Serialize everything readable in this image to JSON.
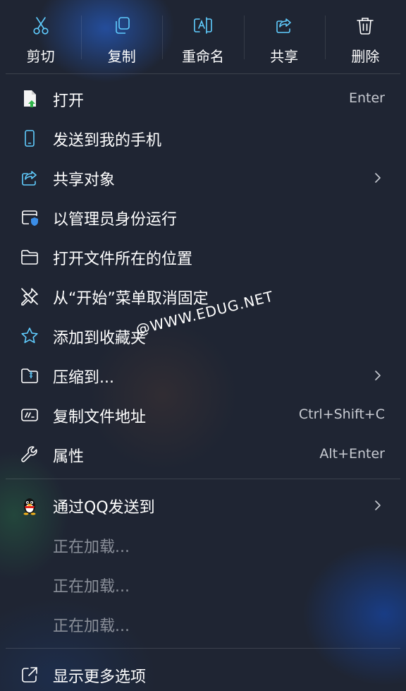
{
  "toolbar": {
    "cut": "剪切",
    "copy": "复制",
    "rename": "重命名",
    "share": "共享",
    "delete": "删除"
  },
  "items": {
    "open": {
      "label": "打开",
      "shortcut": "Enter"
    },
    "send_phone": {
      "label": "发送到我的手机"
    },
    "share_object": {
      "label": "共享对象"
    },
    "run_admin": {
      "label": "以管理员身份运行"
    },
    "open_location": {
      "label": "打开文件所在的位置"
    },
    "unpin_start": {
      "label": "从“开始”菜单取消固定"
    },
    "add_favorites": {
      "label": "添加到收藏夹"
    },
    "compress": {
      "label": "压缩到..."
    },
    "copy_path": {
      "label": "复制文件地址",
      "shortcut": "Ctrl+Shift+C"
    },
    "properties": {
      "label": "属性",
      "shortcut": "Alt+Enter"
    },
    "send_qq": {
      "label": "通过QQ发送到"
    },
    "loading_1": {
      "label": "正在加载..."
    },
    "loading_2": {
      "label": "正在加载..."
    },
    "loading_3": {
      "label": "正在加载..."
    },
    "more_options": {
      "label": "显示更多选项"
    }
  },
  "watermark": "@WWW.EDUG.NET",
  "colors": {
    "accent": "#60cdff",
    "text": "#ffffff",
    "dim_text": "#8a8f99"
  }
}
